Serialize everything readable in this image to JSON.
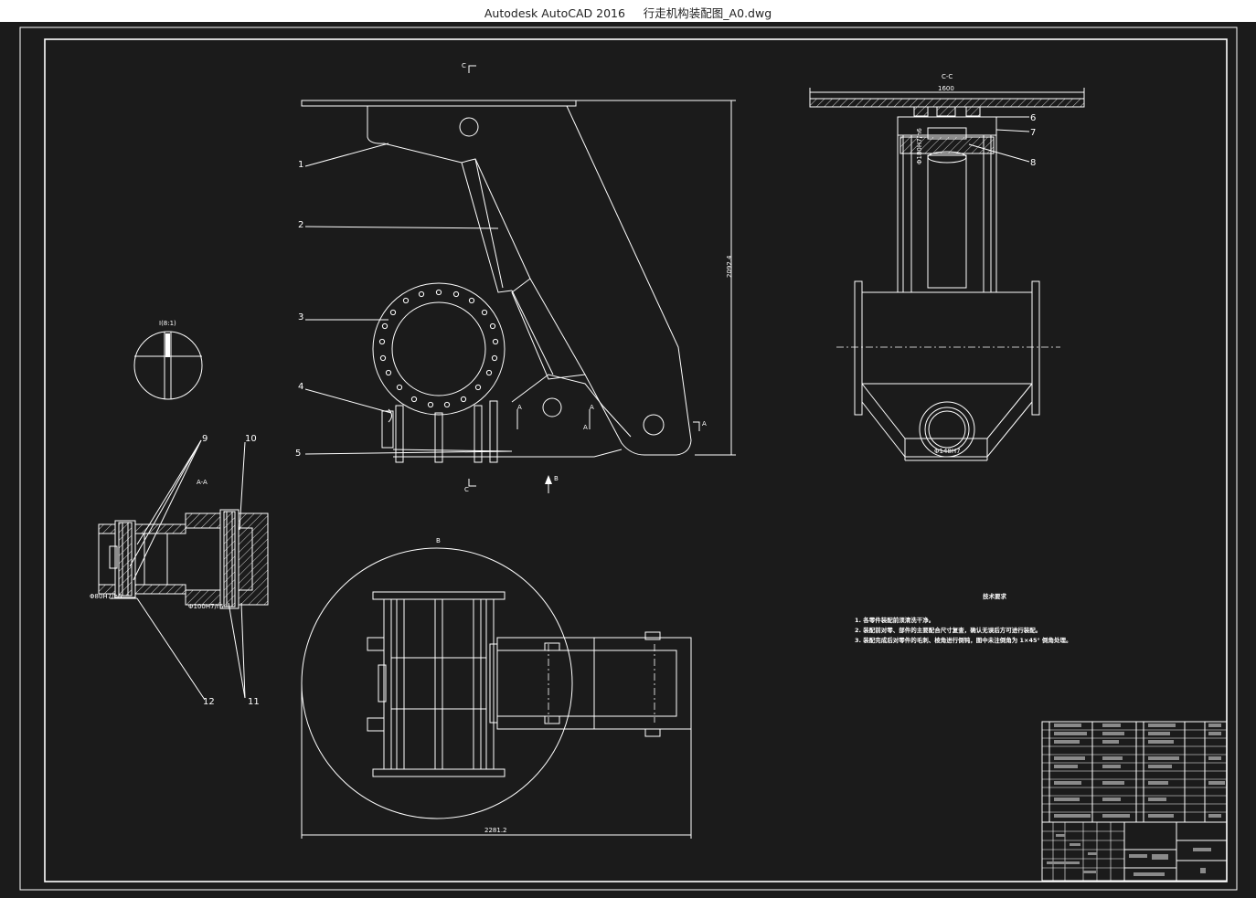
{
  "window": {
    "title": "Autodesk AutoCAD 2016     行走机构装配图_A0.dwg"
  },
  "drawing": {
    "part_numbers": [
      "1",
      "2",
      "3",
      "4",
      "5",
      "6",
      "7",
      "8",
      "9",
      "10",
      "11",
      "12",
      "11"
    ],
    "section_labels": {
      "cc_top": "C",
      "cc_bottom": "C",
      "cc_view": "C-C",
      "aa_view": "A-A",
      "detail": "I(8:1)",
      "a1": "A",
      "a2": "A",
      "a3": "A",
      "a4": "A",
      "b_arrow": "B",
      "b_view": "B"
    },
    "dimensions": {
      "height": "2092.4",
      "width_top": "1600",
      "width_bottom": "2281.2"
    },
    "technical_requirements": {
      "title": "技术要求",
      "items": [
        "1. 各零件装配前须清洗干净。",
        "2. 装配前对零、部件的主要配合尺寸复查，确认无误后方可进行装配。",
        "3. 装配完成后对零件的毛刺、棱角进行倒钝，图中未注倒角为 1×45° 倒角处理。"
      ]
    }
  },
  "icons": {
    "b_arrow": "up-arrow-icon"
  },
  "colors": {
    "background": "#1b1b1b",
    "lines": "#ffffff",
    "titlebar": "#ffffff",
    "titleblock_text": "#8a8a8a"
  }
}
